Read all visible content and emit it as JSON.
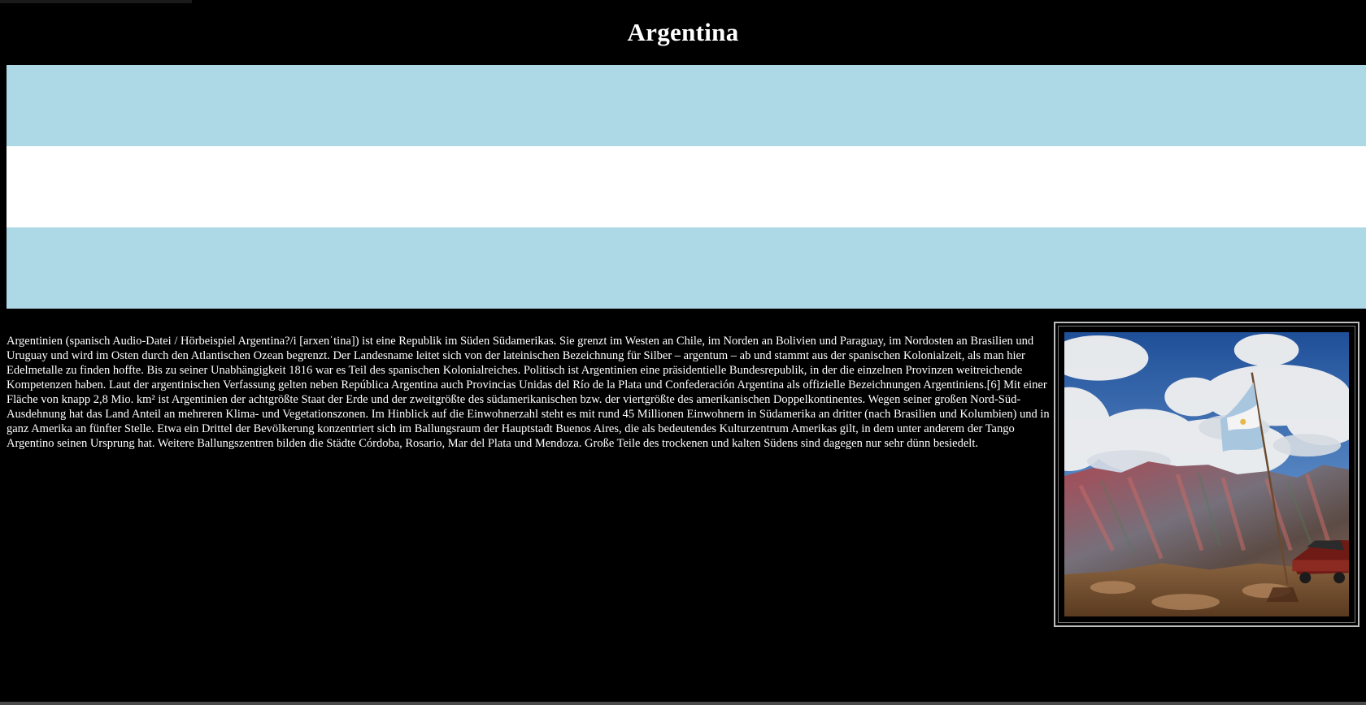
{
  "page": {
    "title": "Argentina"
  },
  "flag": {
    "stripes": [
      "light-blue",
      "white",
      "light-blue"
    ],
    "colors": {
      "light_blue": "#add8e6",
      "white": "#ffffff"
    }
  },
  "content": {
    "paragraph": "Argentinien (spanisch Audio-Datei / Hörbeispiel Argentina?/i [arxenˈtina]) ist eine Republik im Süden Südamerikas. Sie grenzt im Westen an Chile, im Norden an Bolivien und Paraguay, im Nordosten an Brasilien und Uruguay und wird im Osten durch den Atlantischen Ozean begrenzt. Der Landesname leitet sich von der lateinischen Bezeichnung für Silber – argentum – ab und stammt aus der spanischen Kolonialzeit, als man hier Edelmetalle zu finden hoffte. Bis zu seiner Unabhängigkeit 1816 war es Teil des spanischen Kolonialreiches. Politisch ist Argentinien eine präsidentielle Bundesrepublik, in der die einzelnen Provinzen weitreichende Kompetenzen haben. Laut der argentinischen Verfassung gelten neben República Argentina auch Provincias Unidas del Río de la Plata und Confederación Argentina als offizielle Bezeichnungen Argentiniens.[6] Mit einer Fläche von knapp 2,8 Mio. km² ist Argentinien der achtgrößte Staat der Erde und der zweitgrößte des südamerikanischen bzw. der viertgrößte des amerikanischen Doppelkontinentes. Wegen seiner großen Nord-Süd-Ausdehnung hat das Land Anteil an mehreren Klima- und Vegetationszonen. Im Hinblick auf die Einwohnerzahl steht es mit rund 45 Millionen Einwohnern in Südamerika an dritter (nach Brasilien und Kolumbien) und in ganz Amerika an fünfter Stelle. Etwa ein Drittel der Bevölkerung konzentriert sich im Ballungsraum der Hauptstadt Buenos Aires, die als bedeutendes Kulturzentrum Amerikas gilt, in dem unter anderem der Tango Argentino seinen Ursprung hat. Weitere Ballungszentren bilden die Städte Córdoba, Rosario, Mar del Plata und Mendoza. Große Teile des trockenen und kalten Südens sind dagegen nur sehr dünn besiedelt."
  },
  "image": {
    "subject": "argentine-flag-on-mountains-photo"
  }
}
